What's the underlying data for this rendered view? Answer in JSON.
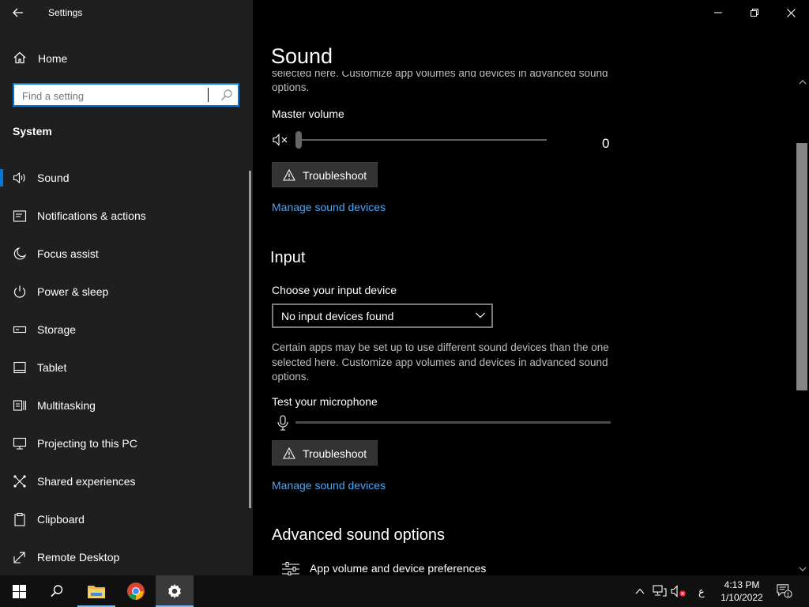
{
  "window": {
    "app_title": "Settings"
  },
  "sidebar": {
    "home_label": "Home",
    "search_placeholder": "Find a setting",
    "section_title": "System",
    "items": [
      {
        "label": "Sound",
        "icon": "speaker-icon",
        "active": true
      },
      {
        "label": "Notifications & actions",
        "icon": "notification-icon"
      },
      {
        "label": "Focus assist",
        "icon": "moon-icon"
      },
      {
        "label": "Power & sleep",
        "icon": "power-icon"
      },
      {
        "label": "Storage",
        "icon": "storage-icon"
      },
      {
        "label": "Tablet",
        "icon": "tablet-icon"
      },
      {
        "label": "Multitasking",
        "icon": "multitasking-icon"
      },
      {
        "label": "Projecting to this PC",
        "icon": "projecting-icon"
      },
      {
        "label": "Shared experiences",
        "icon": "shared-experiences-icon"
      },
      {
        "label": "Clipboard",
        "icon": "clipboard-icon"
      },
      {
        "label": "Remote Desktop",
        "icon": "remote-desktop-icon"
      }
    ]
  },
  "content": {
    "page_title": "Sound",
    "output": {
      "cut_description": "selected here. Customize app volumes and devices in advanced sound options.",
      "master_volume_label": "Master volume",
      "master_volume_value": "0",
      "troubleshoot_label": "Troubleshoot",
      "manage_link": "Manage sound devices"
    },
    "input": {
      "heading": "Input",
      "choose_label": "Choose your input device",
      "selected_device": "No input devices found",
      "description": "Certain apps may be set up to use different sound devices than the one selected here. Customize app volumes and devices in advanced sound options.",
      "test_label": "Test your microphone",
      "troubleshoot_label": "Troubleshoot",
      "manage_link": "Manage sound devices"
    },
    "advanced": {
      "heading": "Advanced sound options",
      "app_volume_label": "App volume and device preferences"
    }
  },
  "taskbar": {
    "apps": [
      "start-icon",
      "search-icon",
      "file-explorer-icon",
      "chrome-icon",
      "settings-icon"
    ],
    "tray": {
      "language": "ع",
      "time": "4:13 PM",
      "date": "1/10/2022",
      "notification_count": "1"
    }
  },
  "colors": {
    "accent": "#0078d7",
    "link": "#4ea5f5",
    "sidebar_bg": "#1f1f1f",
    "content_bg": "#000000"
  }
}
